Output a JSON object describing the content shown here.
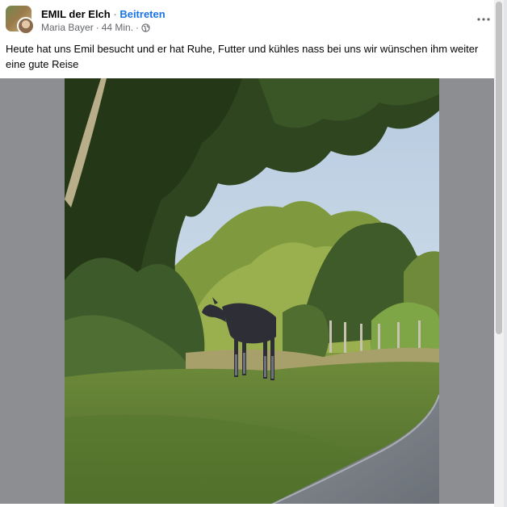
{
  "post": {
    "group_name": "EMIL der Elch",
    "separator": "·",
    "join_label": "Beitreten",
    "author": "Maria Bayer",
    "time": "44 Min.",
    "caption": "Heute hat uns Emil besucht und er hat Ruhe, Futter und kühles nass bei uns wir wünschen ihm weiter eine gute Reise"
  },
  "icons": {
    "avatar": "group-avatar",
    "user_avatar": "user-avatar",
    "globe": "globe-icon",
    "more": "more-options-icon"
  },
  "scroll": {
    "position_fraction": 0
  }
}
